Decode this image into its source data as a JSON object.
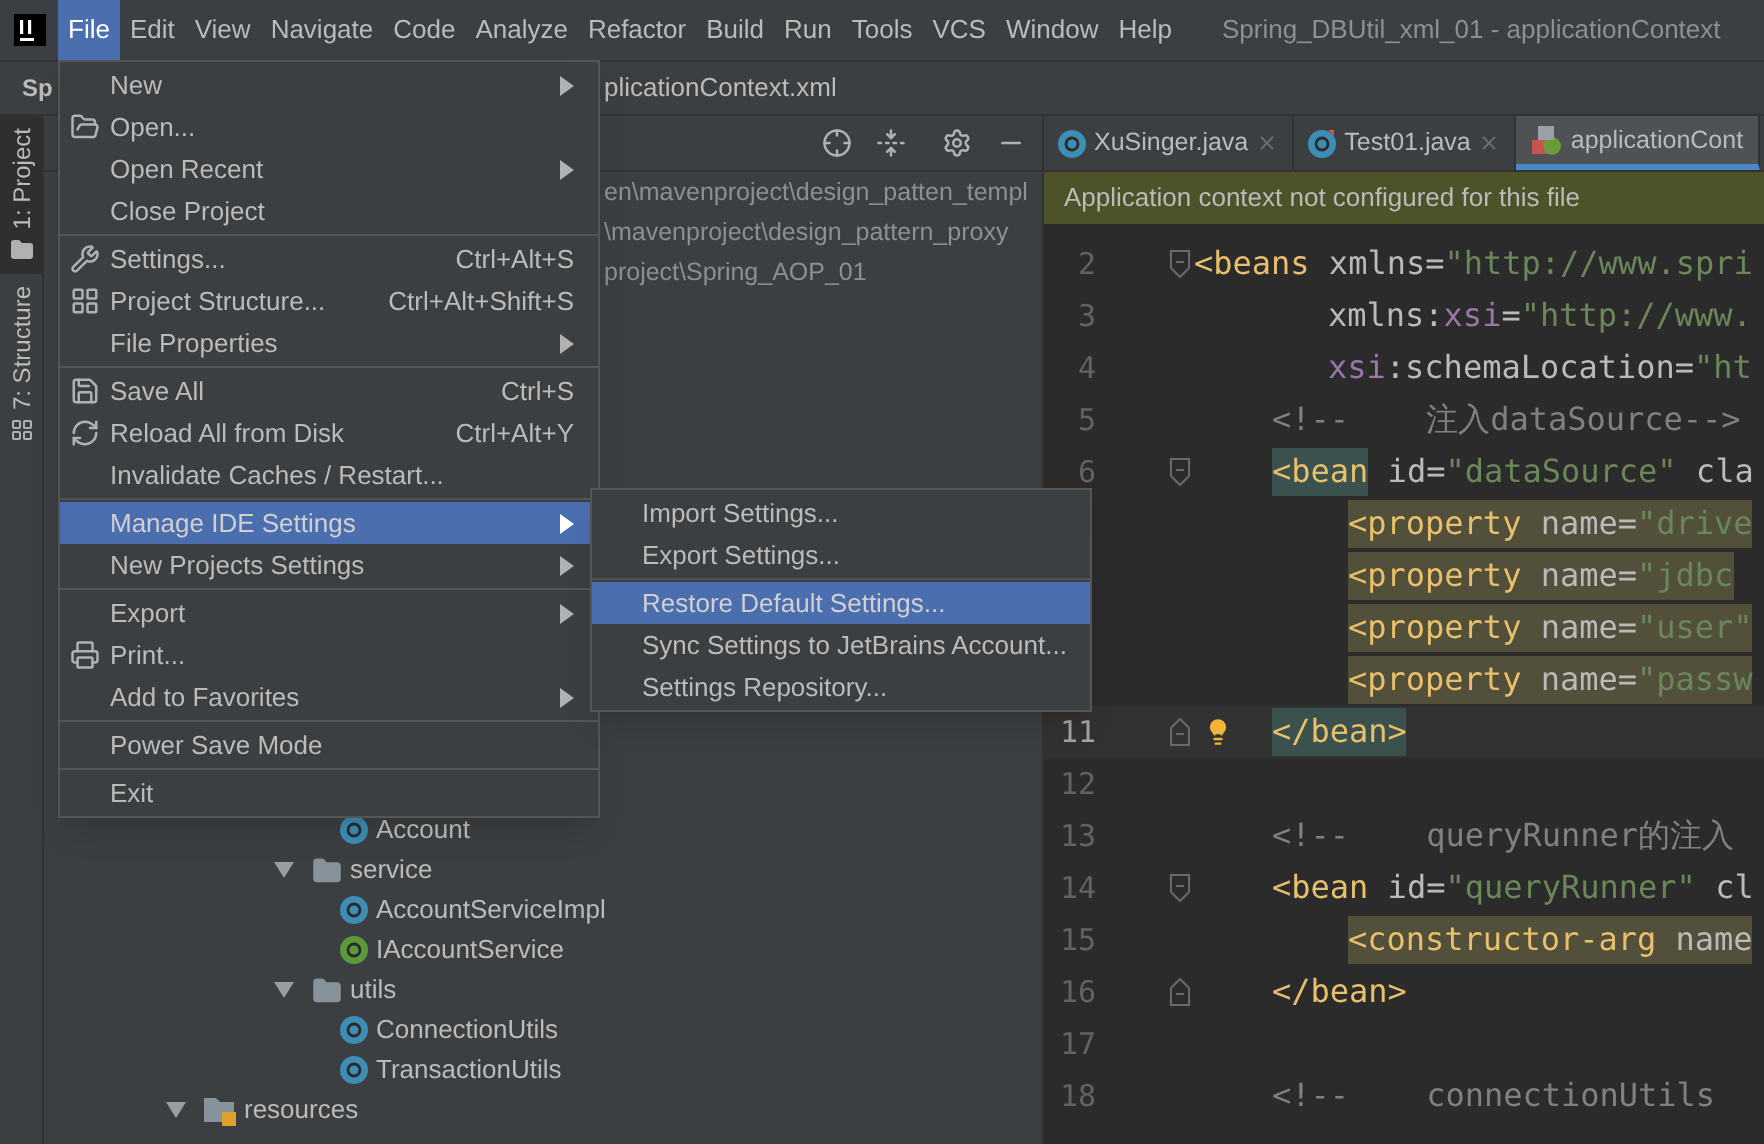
{
  "menubar": {
    "items": [
      {
        "label": "File",
        "selected": true
      },
      {
        "label": "Edit",
        "selected": false
      },
      {
        "label": "View",
        "selected": false
      },
      {
        "label": "Navigate",
        "selected": false
      },
      {
        "label": "Code",
        "selected": false
      },
      {
        "label": "Analyze",
        "selected": false
      },
      {
        "label": "Refactor",
        "selected": false
      },
      {
        "label": "Build",
        "selected": false
      },
      {
        "label": "Run",
        "selected": false
      },
      {
        "label": "Tools",
        "selected": false
      },
      {
        "label": "VCS",
        "selected": false
      },
      {
        "label": "Window",
        "selected": false
      },
      {
        "label": "Help",
        "selected": false
      }
    ],
    "title": "Spring_DBUtil_xml_01 - applicationContext"
  },
  "navbar": {
    "project": "Sp",
    "file": "plicationContext.xml"
  },
  "tool_strip": [
    {
      "label": "1: Project",
      "selected": true
    },
    {
      "label": "7: Structure",
      "selected": false
    }
  ],
  "project": {
    "paths": [
      "en\\mavenproject\\design_patten_templ",
      "\\mavenproject\\design_pattern_proxy",
      "project\\Spring_AOP_01"
    ],
    "tree": {
      "leaves": [
        {
          "name": "Account",
          "kind": "class"
        }
      ],
      "items": [
        {
          "name": "service",
          "kind": "folder",
          "expanded": true,
          "children": [
            {
              "name": "AccountServiceImpl",
              "kind": "class"
            },
            {
              "name": "IAccountService",
              "kind": "interface"
            }
          ]
        },
        {
          "name": "utils",
          "kind": "folder",
          "expanded": true,
          "children": [
            {
              "name": "ConnectionUtils",
              "kind": "class"
            },
            {
              "name": "TransactionUtils",
              "kind": "class"
            }
          ]
        }
      ],
      "roots": [
        {
          "name": "resources",
          "kind": "resources",
          "expanded": true
        }
      ]
    }
  },
  "file_menu": {
    "groups": [
      [
        {
          "label": "New",
          "submenu": true,
          "selected": false
        },
        {
          "label": "Open...",
          "kind": "open",
          "selected": false
        },
        {
          "label": "Open Recent",
          "submenu": true,
          "selected": false
        },
        {
          "label": "Close Project",
          "selected": false
        }
      ],
      [
        {
          "label": "Settings...",
          "kind": "settings",
          "shortcut": "Ctrl+Alt+S",
          "selected": false
        },
        {
          "label": "Project Structure...",
          "kind": "structure",
          "shortcut": "Ctrl+Alt+Shift+S",
          "selected": false
        },
        {
          "label": "File Properties",
          "submenu": true,
          "selected": false
        }
      ],
      [
        {
          "label": "Save All",
          "kind": "save",
          "shortcut": "Ctrl+S",
          "selected": false
        },
        {
          "label": "Reload All from Disk",
          "kind": "reload",
          "shortcut": "Ctrl+Alt+Y",
          "selected": false
        },
        {
          "label": "Invalidate Caches / Restart...",
          "selected": false
        }
      ],
      [
        {
          "label": "Manage IDE Settings",
          "submenu": true,
          "selected": true
        },
        {
          "label": "New Projects Settings",
          "submenu": true,
          "selected": false
        }
      ],
      [
        {
          "label": "Export",
          "submenu": true,
          "selected": false
        },
        {
          "label": "Print...",
          "kind": "print",
          "selected": false
        },
        {
          "label": "Add to Favorites",
          "submenu": true,
          "selected": false
        }
      ],
      [
        {
          "label": "Power Save Mode",
          "selected": false
        }
      ],
      [
        {
          "label": "Exit",
          "selected": false
        }
      ]
    ]
  },
  "settings_submenu": {
    "groups": [
      [
        {
          "label": "Import Settings...",
          "selected": false
        },
        {
          "label": "Export Settings...",
          "selected": false
        }
      ],
      [
        {
          "label": "Restore Default Settings...",
          "selected": true
        },
        {
          "label": "Sync Settings to JetBrains Account...",
          "selected": false
        },
        {
          "label": "Settings Repository...",
          "selected": false
        }
      ]
    ]
  },
  "editor": {
    "tabs": [
      {
        "label": "XuSinger.java",
        "kind": "class",
        "selected": false
      },
      {
        "label": "Test01.java",
        "kind": "test",
        "selected": false
      },
      {
        "label": "applicationCont",
        "kind": "xml",
        "selected": true
      }
    ],
    "banner": "Application context not configured for this file",
    "lines": [
      {
        "number": "2",
        "kind": "root",
        "fold_start": true,
        "tokens": [
          {
            "kind": "tag",
            "text": "<beans"
          },
          {
            "kind": "attr",
            "text": " xmlns="
          },
          {
            "kind": "value",
            "text": "\"http://www.spri"
          }
        ]
      },
      {
        "number": "3",
        "kind": "continued",
        "tokens": [
          {
            "kind": "attr",
            "text": "xmlns:"
          },
          {
            "kind": "ns",
            "text": "xsi"
          },
          {
            "kind": "attr",
            "text": "="
          },
          {
            "kind": "value",
            "text": "\"http://www."
          }
        ]
      },
      {
        "number": "4",
        "kind": "continued",
        "tokens": [
          {
            "kind": "ns",
            "text": "xsi"
          },
          {
            "kind": "attr",
            "text": ":schemaLocation="
          },
          {
            "kind": "value",
            "text": "\"ht"
          }
        ]
      },
      {
        "number": "5",
        "kind": "child",
        "tokens": [
          {
            "kind": "comment",
            "text": "<!--    注入dataSource-->"
          }
        ]
      },
      {
        "number": "6",
        "kind": "child",
        "fold_start": true,
        "tokens": [
          {
            "kind": "tag",
            "text": "<bean",
            "matched": true
          },
          {
            "kind": "attr",
            "text": " id="
          },
          {
            "kind": "value",
            "text": "\"dataSource\""
          },
          {
            "kind": "attr",
            "text": " cla"
          }
        ]
      },
      {
        "kind": "grandchild",
        "warned": true,
        "tokens": [
          {
            "kind": "tag",
            "text": "<property"
          },
          {
            "kind": "attr",
            "text": " name="
          },
          {
            "kind": "value",
            "text": "\"drive"
          }
        ]
      },
      {
        "kind": "grandchild",
        "warned": true,
        "tokens": [
          {
            "kind": "tag",
            "text": "<property"
          },
          {
            "kind": "attr",
            "text": " name="
          },
          {
            "kind": "value",
            "text": "\"jdbc"
          }
        ]
      },
      {
        "kind": "grandchild",
        "warned": true,
        "tokens": [
          {
            "kind": "tag",
            "text": "<property"
          },
          {
            "kind": "attr",
            "text": " name="
          },
          {
            "kind": "value",
            "text": "\"user\""
          }
        ]
      },
      {
        "kind": "grandchild",
        "warned": true,
        "tokens": [
          {
            "kind": "tag",
            "text": "<property"
          },
          {
            "kind": "attr",
            "text": " name="
          },
          {
            "kind": "value",
            "text": "\"passw"
          }
        ]
      },
      {
        "number": "11",
        "kind": "child",
        "fold_end": true,
        "current": true,
        "bulb": true,
        "tokens": [
          {
            "kind": "tag",
            "text": "</bean>",
            "matched": true
          }
        ]
      },
      {
        "number": "12",
        "kind": "root"
      },
      {
        "number": "13",
        "kind": "child",
        "tokens": [
          {
            "kind": "comment",
            "text": "<!--    queryRunner的注入"
          }
        ]
      },
      {
        "number": "14",
        "kind": "child",
        "fold_start": true,
        "tokens": [
          {
            "kind": "tag",
            "text": "<bean"
          },
          {
            "kind": "attr",
            "text": " id="
          },
          {
            "kind": "value",
            "text": "\"queryRunner\""
          },
          {
            "kind": "attr",
            "text": " cl"
          }
        ]
      },
      {
        "number": "15",
        "kind": "grandchild",
        "warned": true,
        "tokens": [
          {
            "kind": "tag",
            "text": "<constructor-arg"
          },
          {
            "kind": "attr",
            "text": " name"
          }
        ]
      },
      {
        "number": "16",
        "kind": "child",
        "fold_end": true,
        "tokens": [
          {
            "kind": "tag",
            "text": "</bean>"
          }
        ]
      },
      {
        "number": "17",
        "kind": "root"
      },
      {
        "number": "18",
        "kind": "child",
        "tokens": [
          {
            "kind": "comment",
            "text": "<!--    connectionUtils"
          }
        ]
      }
    ]
  }
}
